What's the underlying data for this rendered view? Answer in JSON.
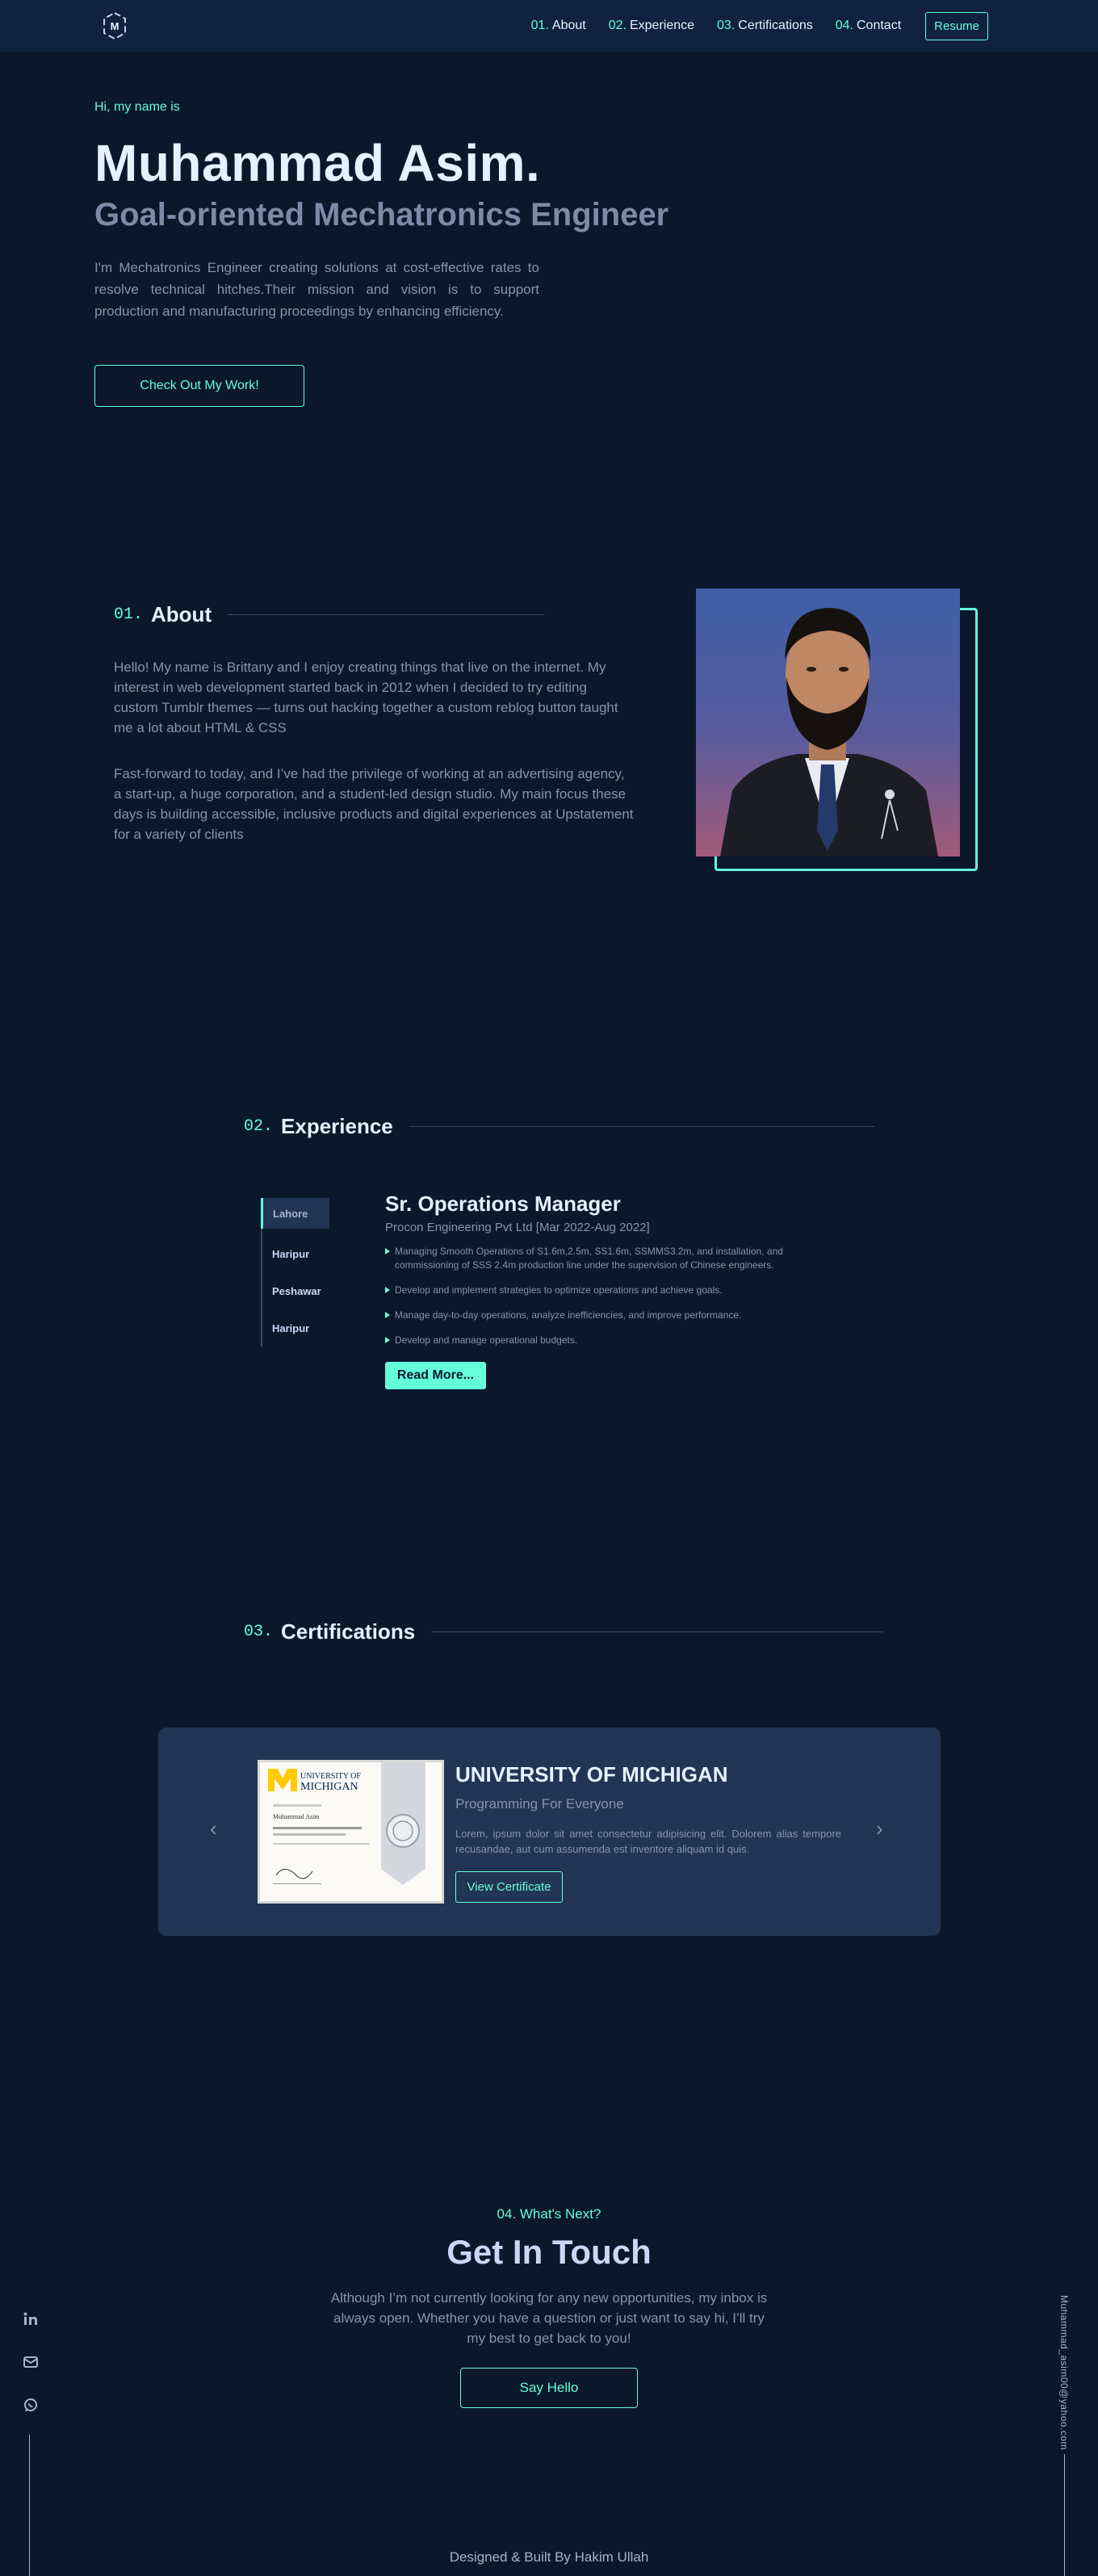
{
  "nav": {
    "links": [
      {
        "num": "01.",
        "label": "About"
      },
      {
        "num": "02.",
        "label": "Experience"
      },
      {
        "num": "03.",
        "label": "Certifications"
      },
      {
        "num": "04.",
        "label": "Contact"
      }
    ],
    "resume_label": "Resume",
    "logo_letter": "M"
  },
  "hero": {
    "greeting": "Hi, my name is",
    "name": "Muhammad Asim.",
    "role": "Goal-oriented Mechatronics Engineer",
    "description": "I'm Mechatronics Engineer creating solutions at cost-effective rates to resolve technical hitches.Their mission and vision is to support production and manufacturing proceedings by enhancing efficiency.",
    "cta_label": "Check Out My Work!"
  },
  "about": {
    "num": "01.",
    "title": "About",
    "paragraphs": [
      "Hello! My name is Brittany and I enjoy creating things that live on the internet. My interest in web development started back in 2012 when I decided to try editing custom Tumblr themes — turns out hacking together a custom reblog button taught me a lot about HTML & CSS",
      "Fast-forward to today, and I’ve had the privilege of working at an advertising agency, a start-up, a huge corporation, and a student-led design studio. My main focus these days is building accessible, inclusive products and digital experiences at Upstatement for a variety of clients"
    ]
  },
  "experience": {
    "num": "02.",
    "title": "Experience",
    "tabs": [
      "Lahore",
      "Haripur",
      "Peshawar",
      "Haripur"
    ],
    "job_title": "Sr. Operations Manager",
    "company": "Procon Engineering Pvt Ltd [Mar 2022-Aug 2022]",
    "bullets": [
      "Managing Smooth Operations of S1.6m,2.5m, SS1.6m, SSMMS3.2m, and installation, and commissioning of SSS 2.4m production line under the supervision of Chinese engineers.",
      "Develop and implement strategies to optimize operations and achieve goals.",
      "Manage day-to-day operations, analyze inefficiencies, and improve performance.",
      "Develop and manage operational budgets."
    ],
    "read_more_label": "Read More..."
  },
  "certifications": {
    "num": "03.",
    "title": "Certifications",
    "org": "UNIVERSITY OF MICHIGAN",
    "course": "Programming For Everyone",
    "description": "Lorem, ipsum dolor sit amet consectetur adipisicing elit. Dolorem alias tempore recusandae, aut cum assumenda est inventore aliquam id quis.",
    "button_label": "View Certificate",
    "prev_arrow": "‹",
    "next_arrow": "›",
    "image": {
      "uni_line1": "UNIVERSITY OF",
      "uni_line2": "MICHIGAN",
      "recipient": "Muhammad Asim"
    }
  },
  "contact": {
    "overline": "04. What's Next?",
    "title": "Get In Touch",
    "description": "Although I’m not currently looking for any new opportunities, my inbox is always open. Whether you have a question or just want to say hi, I’ll try my best to get back to you!",
    "button_label": "Say Hello"
  },
  "side": {
    "email": "Muhammad_asim00@yahoo.com",
    "socials": [
      "linkedin-icon",
      "mail-icon",
      "whatsapp-icon"
    ]
  },
  "footer": {
    "text": "Designed & Built By Hakim Ullah"
  },
  "colors": {
    "background": "#0b172b",
    "nav": "#112240",
    "accent": "#64ffda",
    "heading": "#e6f1ff",
    "body_text": "#8892b0",
    "card": "#233554"
  }
}
